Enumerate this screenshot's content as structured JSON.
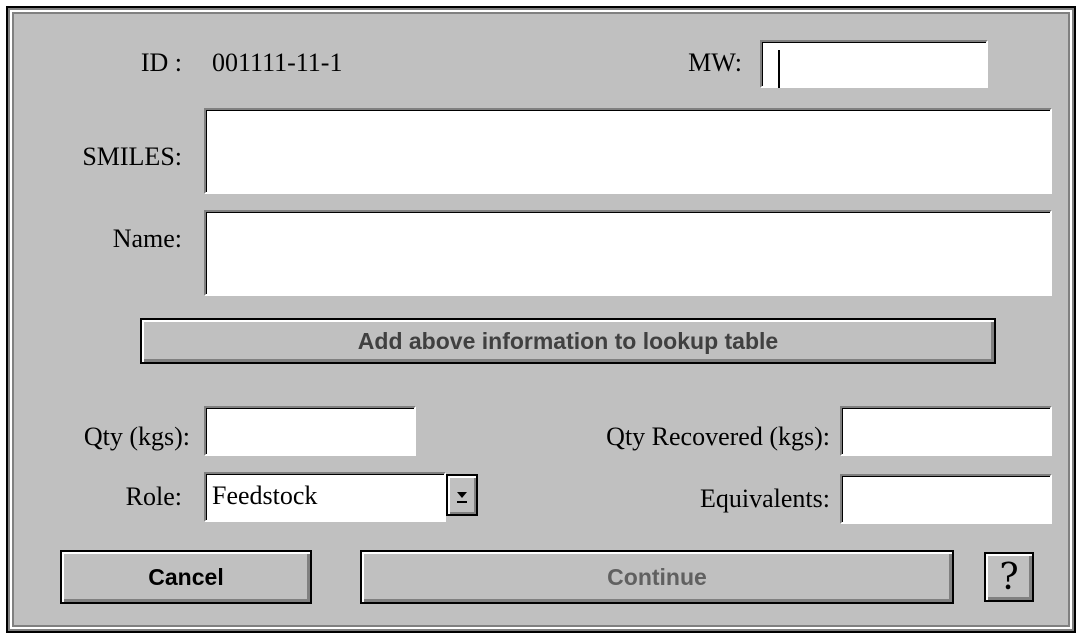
{
  "dialog": {
    "id_label": "ID :",
    "id_value": "001111-11-1",
    "mw_label": "MW:",
    "mw_value": "",
    "smiles_label": "SMILES:",
    "smiles_value": "",
    "name_label": "Name:",
    "name_value": "",
    "add_button_label": "Add above information to lookup table",
    "qty_label": "Qty (kgs):",
    "qty_value": "",
    "qty_recovered_label": "Qty Recovered (kgs):",
    "qty_recovered_value": "",
    "role_label": "Role:",
    "role_selected": "Feedstock",
    "equivalents_label": "Equivalents:",
    "equivalents_value": "",
    "cancel_label": "Cancel",
    "continue_label": "Continue",
    "help_label": "?"
  },
  "icons": {
    "role_dropdown": "chevron-down-icon",
    "help": "question-mark-icon"
  },
  "colors": {
    "dialog_bg": "#c0c0c0",
    "field_bg": "#ffffff",
    "disabled_text": "#606060"
  }
}
